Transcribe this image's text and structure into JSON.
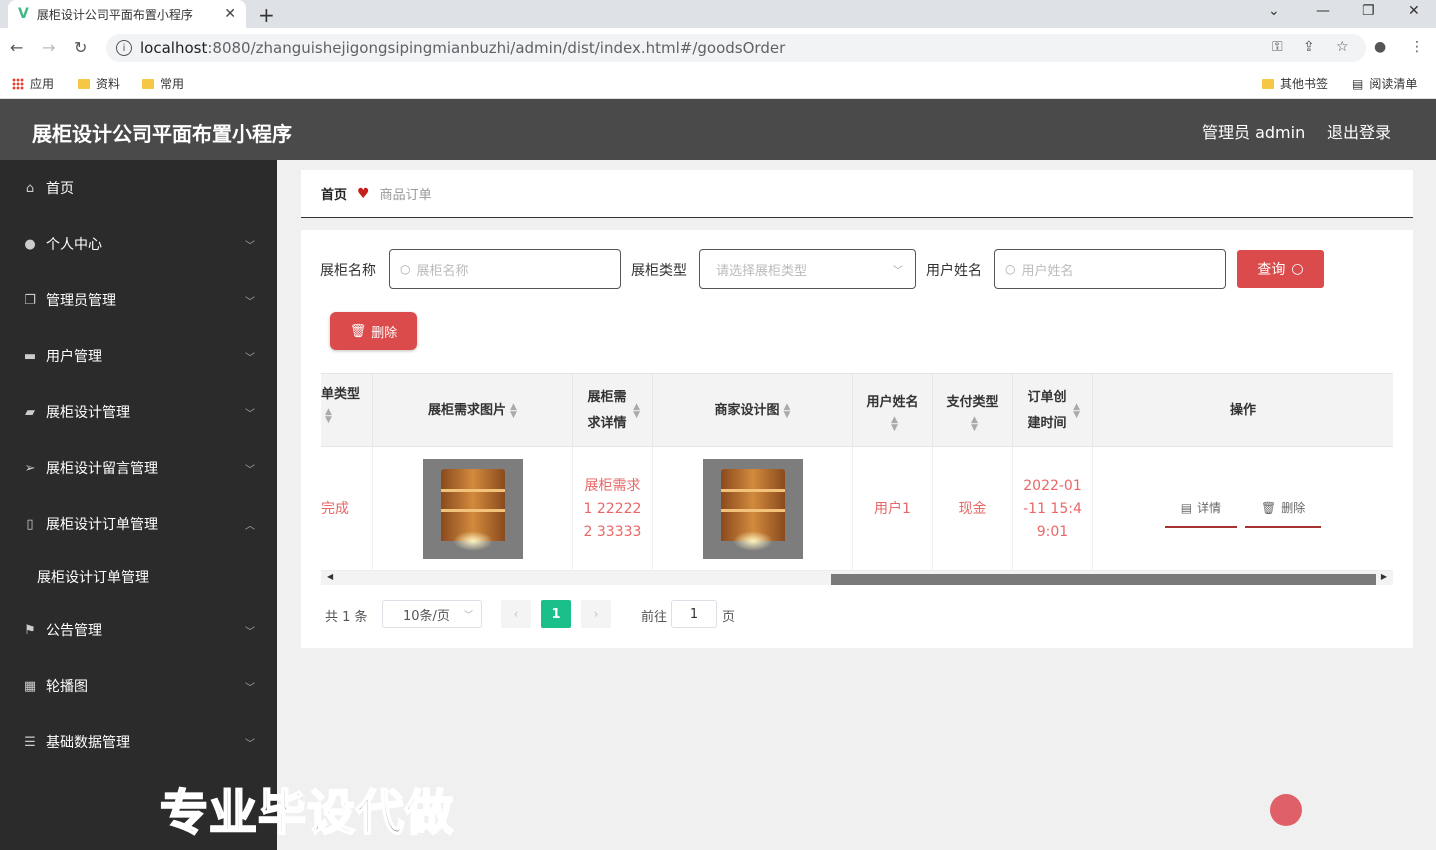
{
  "browser": {
    "tab_title": "展柜设计公司平面布置小程序",
    "url_host": "localhost",
    "url_path": ":8080/zhanguishejigongsipingmianbuzhi/admin/dist/index.html#/goodsOrder",
    "bookmarks": [
      "应用",
      "资料",
      "常用"
    ],
    "bookmarks_right": [
      "其他书签",
      "阅读清单"
    ]
  },
  "header": {
    "title": "展柜设计公司平面布置小程序",
    "user": "管理员 admin",
    "logout": "退出登录"
  },
  "sidebar": {
    "items": [
      {
        "label": "首页",
        "icon": "home-icon"
      },
      {
        "label": "个人中心",
        "icon": "user-icon"
      },
      {
        "label": "管理员管理",
        "icon": "copy-icon"
      },
      {
        "label": "用户管理",
        "icon": "monitor-icon"
      },
      {
        "label": "展柜设计管理",
        "icon": "briefcase-icon"
      },
      {
        "label": "展柜设计留言管理",
        "icon": "send-icon"
      },
      {
        "label": "展柜设计订单管理",
        "icon": "phone-icon"
      },
      {
        "label": "公告管理",
        "icon": "flag-icon"
      },
      {
        "label": "轮播图",
        "icon": "grid-icon"
      },
      {
        "label": "基础数据管理",
        "icon": "list-icon"
      }
    ],
    "submenu": "展柜设计订单管理"
  },
  "breadcrumb": {
    "home": "首页",
    "current": "商品订单"
  },
  "filters": {
    "name_label": "展柜名称",
    "name_placeholder": "展柜名称",
    "type_label": "展柜类型",
    "type_placeholder": "请选择展柜类型",
    "user_label": "用户姓名",
    "user_placeholder": "用户姓名",
    "query_label": "查询",
    "delete_label": "删除"
  },
  "table": {
    "headers": [
      "单类型",
      "展柜需求图片",
      "展柜需求详情",
      "商家设计图",
      "用户姓名",
      "支付类型",
      "订单创建时间",
      "操作"
    ],
    "row": {
      "status": "完成",
      "demand_detail": "展柜需求1 22222 2 33333",
      "user_name": "用户1",
      "pay_type": "现金",
      "created": "2022-01-11 15:49:01",
      "detail_btn": "详情",
      "delete_btn": "删除"
    }
  },
  "pagination": {
    "total": "共 1 条",
    "page_size": "10条/页",
    "current_page": "1",
    "goto_label": "前往",
    "goto_value": "1",
    "page_unit": "页"
  },
  "watermark": "专业毕设代做",
  "colors": {
    "accent": "#dc4b4b",
    "sidebar_bg": "#2b2b2b",
    "topbar_bg": "#4a4a4a",
    "page_active": "#1bbf8a",
    "cell_text": "#e86767"
  }
}
